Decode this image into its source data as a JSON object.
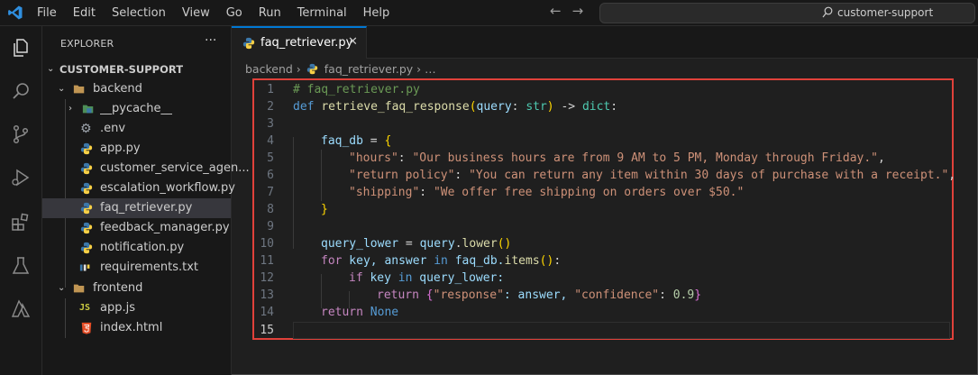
{
  "menu": [
    "File",
    "Edit",
    "Selection",
    "View",
    "Go",
    "Run",
    "Terminal",
    "Help"
  ],
  "search": {
    "text": "customer-support",
    "icon": "search-icon"
  },
  "activity_icons": [
    "explorer-icon",
    "search-icon",
    "source-control-icon",
    "run-debug-icon",
    "extensions-icon",
    "testing-icon",
    "azure-icon"
  ],
  "explorer": {
    "title": "EXPLORER",
    "more": "···",
    "root": "CUSTOMER-SUPPORT",
    "items": [
      {
        "label": "backend",
        "kind": "folder-open"
      },
      {
        "label": "__pycache__",
        "kind": "folder-closed"
      },
      {
        "label": ".env",
        "kind": "gear"
      },
      {
        "label": "app.py",
        "kind": "python"
      },
      {
        "label": "customer_service_agen...",
        "kind": "python"
      },
      {
        "label": "escalation_workflow.py",
        "kind": "python"
      },
      {
        "label": "faq_retriever.py",
        "kind": "python"
      },
      {
        "label": "feedback_manager.py",
        "kind": "python"
      },
      {
        "label": "notification.py",
        "kind": "python"
      },
      {
        "label": "requirements.txt",
        "kind": "pip"
      },
      {
        "label": "frontend",
        "kind": "folder-open"
      },
      {
        "label": "app.js",
        "kind": "js"
      },
      {
        "label": "index.html",
        "kind": "html"
      }
    ]
  },
  "tab": {
    "label": "faq_retriever.py",
    "close": "✕"
  },
  "breadcrumb": {
    "folder": "backend",
    "file": "faq_retriever.py",
    "tail": "…"
  },
  "code": {
    "line_numbers": [
      "1",
      "2",
      "3",
      "4",
      "5",
      "6",
      "7",
      "8",
      "9",
      "10",
      "11",
      "12",
      "13",
      "14",
      "15"
    ],
    "active_line": 15,
    "l1": "# faq_retriever.py",
    "l2": {
      "kw": "def",
      "fn": "retrieve_faq_response",
      "p1": "(",
      "param": "query",
      "colon": ": ",
      "t1": "str",
      "p2": ")",
      "arrow": " -> ",
      "t2": "dict",
      "end": ":"
    },
    "l4": {
      "var": "faq_db",
      "eq": " = ",
      "open": "{"
    },
    "l5": {
      "key": "\"hours\"",
      "sep": ": ",
      "val": "\"Our business hours are from 9 AM to 5 PM, Monday through Friday.\"",
      "end": ","
    },
    "l6": {
      "key": "\"return policy\"",
      "sep": ": ",
      "val": "\"You can return any item within 30 days of purchase with a receipt.\"",
      "end": ","
    },
    "l7": {
      "key": "\"shipping\"",
      "sep": ": ",
      "val": "\"We offer free shipping on orders over $50.\""
    },
    "l8": {
      "close": "}"
    },
    "l10": {
      "var": "query_lower",
      "eq": " = ",
      "obj": "query",
      "dot": ".",
      "meth": "lower",
      "call": "()"
    },
    "l11": {
      "kw": "for",
      "a": " key, answer ",
      "in": "in",
      "b": " faq_db.",
      "meth": "items",
      "call": "()",
      "end": ":"
    },
    "l12": {
      "kw": "if",
      "a": " key ",
      "in": "in",
      "b": " query_lower:"
    },
    "l13": {
      "kw": "return",
      "sp": " ",
      "open": "{",
      "k1": "\"response\"",
      "s1": ": answer, ",
      "k2": "\"confidence\"",
      "s2": ": ",
      "num": "0.9",
      "close": "}"
    },
    "l14": {
      "kw": "return",
      "sp": " ",
      "none": "None"
    }
  }
}
